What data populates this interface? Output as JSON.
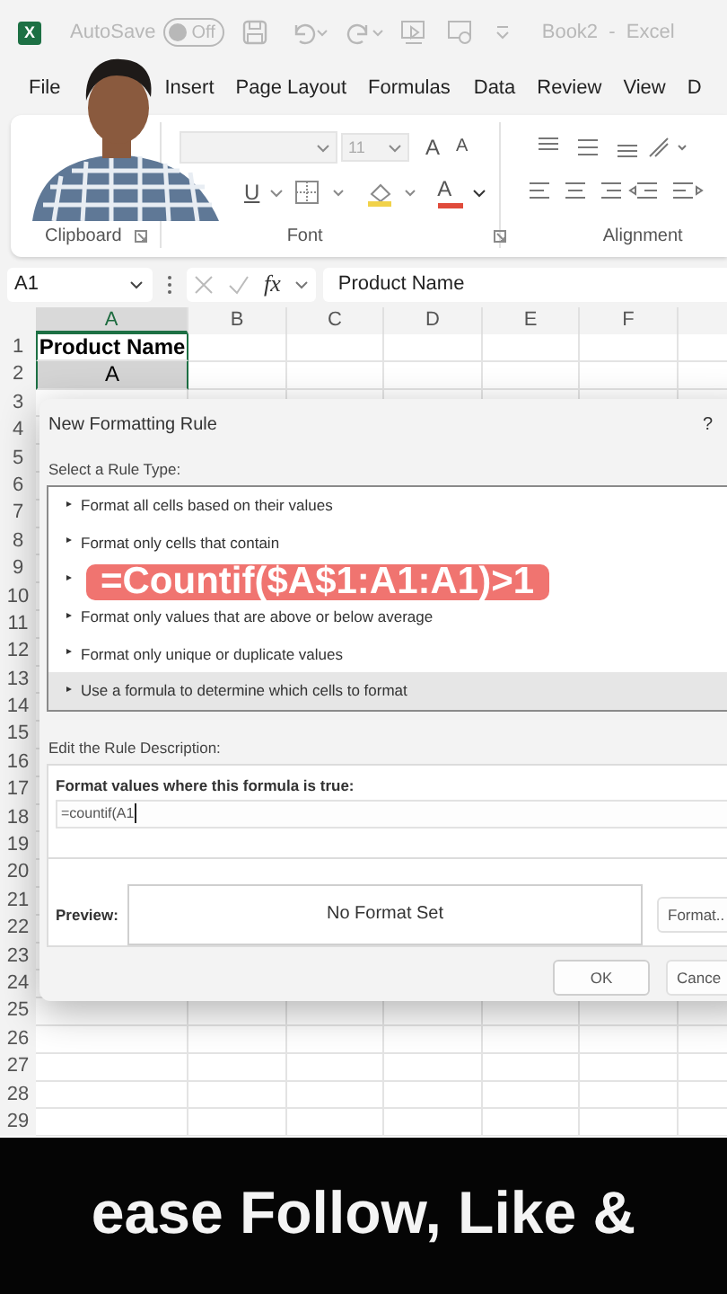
{
  "titlebar": {
    "logo_letter": "X",
    "autosave_label": "AutoSave",
    "autosave_toggle": {
      "label": "Off",
      "on": false
    },
    "title": "Book2  -  Excel"
  },
  "tabs": [
    {
      "label": "File",
      "selected": false
    },
    {
      "label": "Insert",
      "selected": false
    },
    {
      "label": "Page Layout",
      "selected": false
    },
    {
      "label": "Formulas",
      "selected": false
    },
    {
      "label": "Data",
      "selected": false
    },
    {
      "label": "Review",
      "selected": false
    },
    {
      "label": "View",
      "selected": false
    },
    {
      "label": "D",
      "selected": false
    }
  ],
  "ribbon": {
    "font_size": "11",
    "font_glyphs": [
      {
        "char": "A",
        "kind": "grow"
      },
      {
        "char": "A",
        "kind": "shrink"
      }
    ],
    "format_glyphs": [
      {
        "char": "U",
        "kind": "underline"
      },
      {
        "char": "A",
        "kind": "color"
      }
    ],
    "groups": [
      {
        "label": "Clipboard",
        "launcher": true
      },
      {
        "label": "Font",
        "launcher": true
      },
      {
        "label": "Alignment",
        "launcher": false
      }
    ]
  },
  "formula_bar": {
    "name_box": "A1",
    "fx_label": "fx",
    "formula": "Product Name"
  },
  "grid": {
    "columns": [
      {
        "label": "A",
        "selected": true
      },
      {
        "label": "B",
        "selected": false
      },
      {
        "label": "C",
        "selected": false
      },
      {
        "label": "D",
        "selected": false
      },
      {
        "label": "E",
        "selected": false
      },
      {
        "label": "F",
        "selected": false
      }
    ],
    "rows": [
      {
        "number": "1",
        "cells": [
          {
            "text": "Product Name",
            "selected": false
          }
        ]
      },
      {
        "number": "2",
        "cells": [
          {
            "text": "A",
            "selected": true
          }
        ]
      },
      {
        "number": "3"
      },
      {
        "number": "4"
      },
      {
        "number": "5"
      },
      {
        "number": "6"
      },
      {
        "number": "7"
      },
      {
        "number": "8"
      },
      {
        "number": "9"
      },
      {
        "number": "10"
      },
      {
        "number": "11"
      },
      {
        "number": "12"
      },
      {
        "number": "13"
      },
      {
        "number": "14"
      },
      {
        "number": "15"
      },
      {
        "number": "16"
      },
      {
        "number": "17"
      },
      {
        "number": "18"
      },
      {
        "number": "19"
      },
      {
        "number": "20"
      },
      {
        "number": "21"
      },
      {
        "number": "22"
      },
      {
        "number": "23"
      },
      {
        "number": "24"
      },
      {
        "number": "25"
      },
      {
        "number": "26"
      },
      {
        "number": "27"
      },
      {
        "number": "28"
      },
      {
        "number": "29"
      }
    ]
  },
  "dialog": {
    "title": "New Formatting Rule",
    "help": "?",
    "rule_type_label": "Select a Rule Type:",
    "rule_types": [
      {
        "label": "Format all cells based on their values",
        "selected": false
      },
      {
        "label": "Format only cells that contain",
        "selected": false
      },
      {
        "selected": false
      },
      {
        "label": "Format only values that are above or below average",
        "selected": false
      },
      {
        "label": "Format only unique or duplicate values",
        "selected": false
      },
      {
        "label": "Use a formula to determine which cells to format",
        "selected": true
      }
    ],
    "description_label": "Edit the Rule Description:",
    "formula_label": "Format values where this formula is true:",
    "formula_value": "=countif(A1",
    "preview_label": "Preview:",
    "preview_text": "No Format Set",
    "format_button": "Format..",
    "ok_button": "OK",
    "cancel_button": "Cance"
  },
  "overlay_text": "=Countif($A$1:A1:A1)>1",
  "caption": "ease Follow, Like &"
}
